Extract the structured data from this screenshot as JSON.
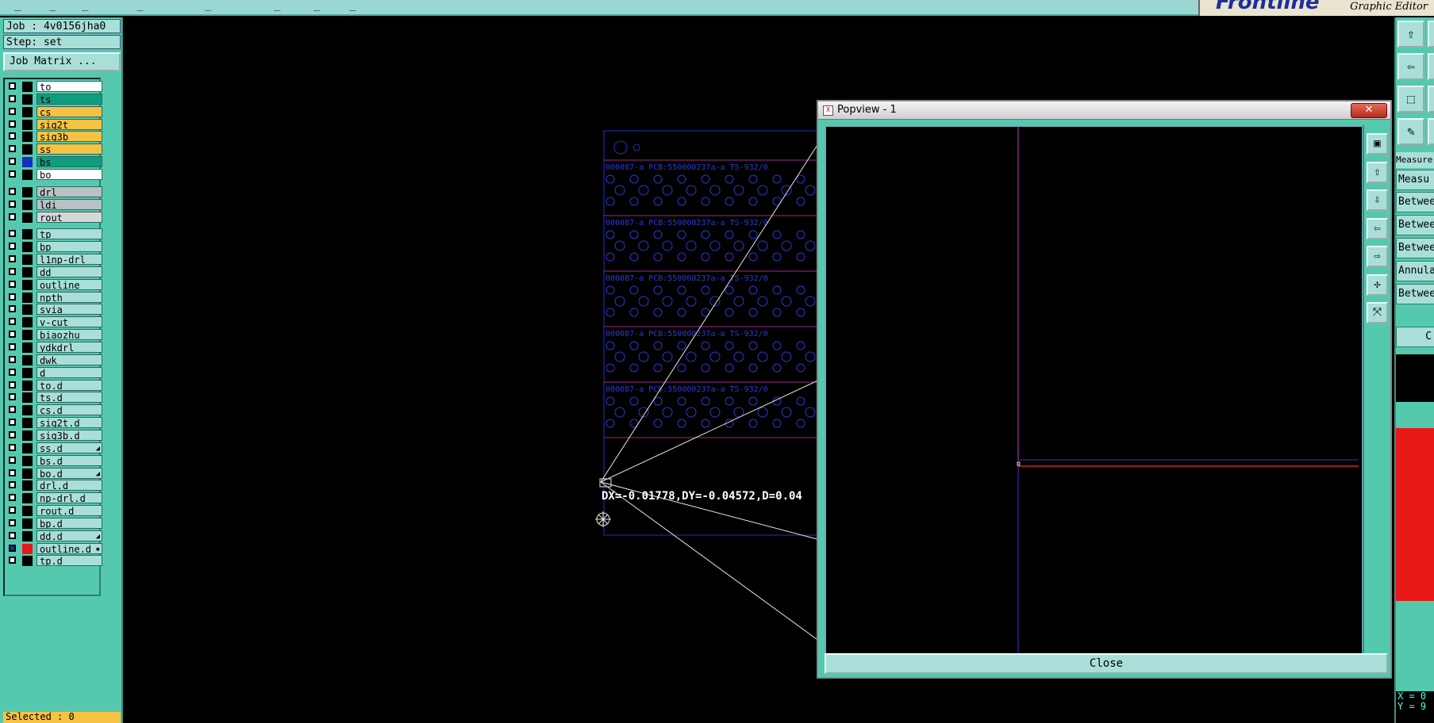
{
  "topbar": {
    "menu_dashes": [
      "_",
      "_",
      "_",
      "_",
      "_",
      "_",
      "_",
      "_"
    ]
  },
  "brand": {
    "logo_text": "Frontline",
    "subtitle": "Graphic Editor"
  },
  "left_panel": {
    "job": "Job : 4v0156jha0",
    "step": "Step: set",
    "job_matrix_label": "Job Matrix ...",
    "layers": [
      {
        "name": "to",
        "bg": "#ffffff",
        "color": "#000000",
        "checked": false,
        "flag": ""
      },
      {
        "name": "ts",
        "bg": "#0e9e7d",
        "color": "#000000",
        "checked": false,
        "flag": ""
      },
      {
        "name": "cs",
        "bg": "#f6c244",
        "color": "#000000",
        "checked": false,
        "flag": ""
      },
      {
        "name": "sig2t",
        "bg": "#f6c244",
        "color": "#000000",
        "checked": false,
        "flag": ""
      },
      {
        "name": "sig3b",
        "bg": "#f6c244",
        "color": "#000000",
        "checked": false,
        "flag": ""
      },
      {
        "name": "ss",
        "bg": "#f6c244",
        "color": "#000000",
        "checked": false,
        "flag": ""
      },
      {
        "name": "bs",
        "bg": "#0e9e7d",
        "color": "#1530c0",
        "checked": false,
        "flag": ""
      },
      {
        "name": "bo",
        "bg": "#ffffff",
        "color": "#000000",
        "checked": false,
        "flag": ""
      },
      {
        "name": "drl",
        "bg": "#b9c1c4",
        "color": "#000000",
        "checked": false,
        "flag": ""
      },
      {
        "name": "ldi",
        "bg": "#b9c1c4",
        "color": "#000000",
        "checked": false,
        "flag": ""
      },
      {
        "name": "rout",
        "bg": "#d8d8d8",
        "color": "#000000",
        "checked": false,
        "flag": ""
      },
      {
        "name": "tp",
        "bg": "#a9dfd8",
        "color": "#000000",
        "checked": false,
        "flag": ""
      },
      {
        "name": "bp",
        "bg": "#a9dfd8",
        "color": "#000000",
        "checked": false,
        "flag": ""
      },
      {
        "name": "l1np-drl",
        "bg": "#a9dfd8",
        "color": "#000000",
        "checked": false,
        "flag": ""
      },
      {
        "name": "dd",
        "bg": "#a9dfd8",
        "color": "#000000",
        "checked": false,
        "flag": ""
      },
      {
        "name": "outline",
        "bg": "#a9dfd8",
        "color": "#000000",
        "checked": false,
        "flag": ""
      },
      {
        "name": "npth",
        "bg": "#a9dfd8",
        "color": "#000000",
        "checked": false,
        "flag": ""
      },
      {
        "name": "svia",
        "bg": "#a9dfd8",
        "color": "#000000",
        "checked": false,
        "flag": ""
      },
      {
        "name": "v-cut",
        "bg": "#a9dfd8",
        "color": "#000000",
        "checked": false,
        "flag": ""
      },
      {
        "name": "biaozhu",
        "bg": "#a9dfd8",
        "color": "#000000",
        "checked": false,
        "flag": ""
      },
      {
        "name": "ydkdrl",
        "bg": "#a9dfd8",
        "color": "#000000",
        "checked": false,
        "flag": ""
      },
      {
        "name": "dwk",
        "bg": "#a9dfd8",
        "color": "#000000",
        "checked": false,
        "flag": ""
      },
      {
        "name": "d",
        "bg": "#a9dfd8",
        "color": "#000000",
        "checked": false,
        "flag": ""
      },
      {
        "name": "to.d",
        "bg": "#a9dfd8",
        "color": "#000000",
        "checked": false,
        "flag": ""
      },
      {
        "name": "ts.d",
        "bg": "#a9dfd8",
        "color": "#000000",
        "checked": false,
        "flag": ""
      },
      {
        "name": "cs.d",
        "bg": "#a9dfd8",
        "color": "#000000",
        "checked": false,
        "flag": ""
      },
      {
        "name": "sig2t.d",
        "bg": "#a9dfd8",
        "color": "#000000",
        "checked": false,
        "flag": ""
      },
      {
        "name": "sig3b.d",
        "bg": "#a9dfd8",
        "color": "#000000",
        "checked": false,
        "flag": ""
      },
      {
        "name": "ss.d",
        "bg": "#a9dfd8",
        "color": "#000000",
        "checked": false,
        "flag": "◢"
      },
      {
        "name": "bs.d",
        "bg": "#a9dfd8",
        "color": "#000000",
        "checked": false,
        "flag": ""
      },
      {
        "name": "bo.d",
        "bg": "#a9dfd8",
        "color": "#000000",
        "checked": false,
        "flag": "◢"
      },
      {
        "name": "drl.d",
        "bg": "#a9dfd8",
        "color": "#000000",
        "checked": false,
        "flag": ""
      },
      {
        "name": "np-drl.d",
        "bg": "#a9dfd8",
        "color": "#000000",
        "checked": false,
        "flag": ""
      },
      {
        "name": "rout.d",
        "bg": "#a9dfd8",
        "color": "#000000",
        "checked": false,
        "flag": ""
      },
      {
        "name": "bp.d",
        "bg": "#a9dfd8",
        "color": "#000000",
        "checked": false,
        "flag": ""
      },
      {
        "name": "dd.d",
        "bg": "#a9dfd8",
        "color": "#000000",
        "checked": false,
        "flag": "◢"
      },
      {
        "name": "outline.d",
        "bg": "#a9dfd8",
        "color": "#e81818",
        "checked": true,
        "flag": "▪"
      },
      {
        "name": "tp.d",
        "bg": "#a9dfd8",
        "color": "#000000",
        "checked": false,
        "flag": ""
      }
    ],
    "selected": "Selected : 0"
  },
  "canvas": {
    "measure_readout": "DX=-0.01778,DY=-0.04572,D=0.04",
    "panel_text": "000087-a PCB:550000237a-a TS-932/0"
  },
  "popview": {
    "title": "Popview - 1",
    "close_x": "✕",
    "close_label": "Close",
    "tools": [
      "▣",
      "⇧",
      "⇩",
      "⇦",
      "⇨",
      "✢",
      "⤧"
    ]
  },
  "right_panel": {
    "tools": [
      "⇧",
      "⇦",
      "⬚",
      "✎"
    ],
    "measure_title": "Measure P",
    "items": [
      "Measu",
      "Betwee",
      "Betwee",
      "Betwee",
      "Annula",
      "Betwee"
    ],
    "c_label": "C",
    "x_label": "X = 0",
    "y_label": "Y = 9"
  }
}
